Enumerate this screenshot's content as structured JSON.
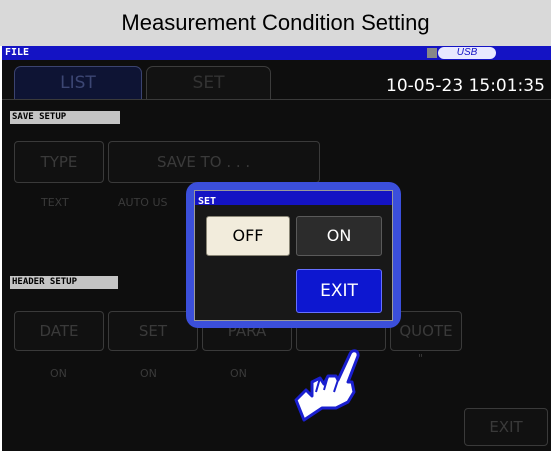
{
  "page_title": "Measurement Condition Setting",
  "header": {
    "file_label": "FILE",
    "usb_label": "USB",
    "datetime": "10-05-23 15:01:35"
  },
  "tabs": [
    {
      "label": "LIST"
    },
    {
      "label": "SET"
    }
  ],
  "save_setup": {
    "section_label": "SAVE SETUP",
    "type_button": "TYPE",
    "type_value": "TEXT",
    "save_to_button": "SAVE TO . . .",
    "save_to_value": "AUTO  US"
  },
  "header_setup": {
    "section_label": "HEADER SETUP",
    "buttons": [
      {
        "label": "DATE",
        "value": "ON"
      },
      {
        "label": "SET",
        "value": "ON"
      },
      {
        "label": "PARA",
        "value": "ON"
      },
      {
        "label": "",
        "value": ""
      },
      {
        "label": "QUOTE",
        "value": "\""
      }
    ]
  },
  "exit_button": "EXIT",
  "dialog": {
    "title": "SET",
    "off_label": "OFF",
    "on_label": "ON",
    "exit_label": "EXIT"
  },
  "colors": {
    "accent_blue": "#1413c4",
    "dialog_ring": "#3b4fdb",
    "exit_blue": "#0d17d0"
  },
  "icons": {
    "usb": "usb-icon",
    "hand": "pointing-hand-icon"
  }
}
